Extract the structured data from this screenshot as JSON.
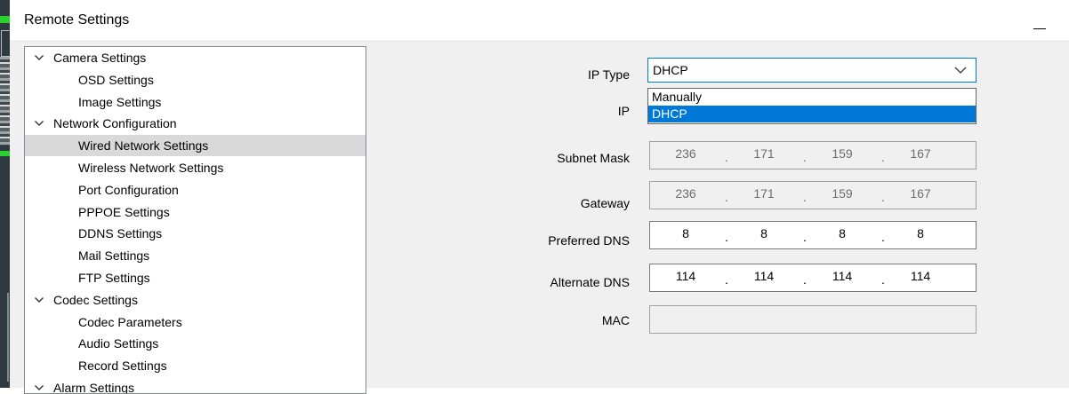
{
  "window": {
    "title": "Remote Settings"
  },
  "tree": {
    "items": [
      {
        "label": "Camera Settings",
        "type": "category"
      },
      {
        "label": "OSD Settings",
        "type": "child"
      },
      {
        "label": "Image Settings",
        "type": "child"
      },
      {
        "label": "Network Configuration",
        "type": "category"
      },
      {
        "label": "Wired Network Settings",
        "type": "child",
        "selected": true
      },
      {
        "label": "Wireless Network Settings",
        "type": "child"
      },
      {
        "label": "Port Configuration",
        "type": "child"
      },
      {
        "label": "PPPOE Settings",
        "type": "child"
      },
      {
        "label": "DDNS Settings",
        "type": "child"
      },
      {
        "label": "Mail Settings",
        "type": "child"
      },
      {
        "label": "FTP Settings",
        "type": "child"
      },
      {
        "label": "Codec Settings",
        "type": "category"
      },
      {
        "label": "Codec Parameters",
        "type": "child"
      },
      {
        "label": "Audio Settings",
        "type": "child"
      },
      {
        "label": "Record Settings",
        "type": "child"
      },
      {
        "label": "Alarm Settings",
        "type": "category"
      }
    ]
  },
  "form": {
    "ip_type": {
      "label": "IP Type",
      "value": "DHCP",
      "options": [
        "Manually",
        "DHCP"
      ],
      "highlighted": "DHCP"
    },
    "ip": {
      "label": "IP"
    },
    "subnet_mask": {
      "label": "Subnet Mask",
      "octets": [
        "236",
        "171",
        "159",
        "167"
      ],
      "enabled": false
    },
    "gateway": {
      "label": "Gateway",
      "octets": [
        "236",
        "171",
        "159",
        "167"
      ],
      "enabled": false
    },
    "preferred_dns": {
      "label": "Preferred DNS",
      "octets": [
        "8",
        "8",
        "8",
        "8"
      ],
      "enabled": true
    },
    "alternate_dns": {
      "label": "Alternate DNS",
      "octets": [
        "114",
        "114",
        "114",
        "114"
      ],
      "enabled": true
    },
    "mac": {
      "label": "MAC",
      "value": ""
    }
  },
  "colors": {
    "accent": "#0078d7",
    "selection": "#d9d9d9",
    "background": "#f0f0f0"
  }
}
